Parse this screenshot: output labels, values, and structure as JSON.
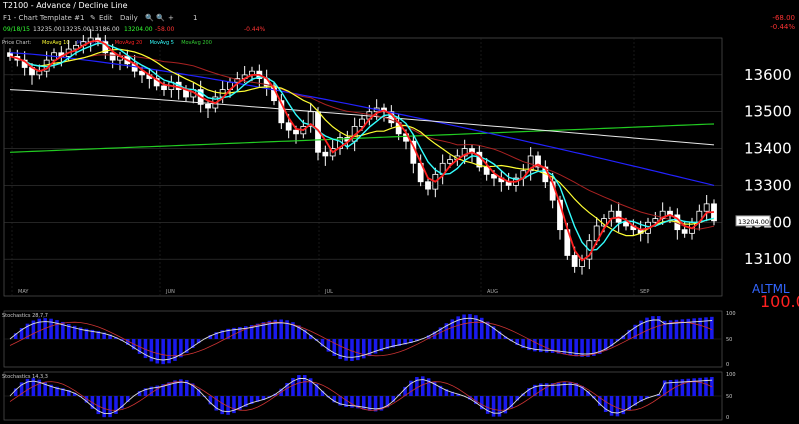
{
  "window": {
    "title": "T2100  -  Advance / Decline Line"
  },
  "toolbar": {
    "template": "F1 - Chart Template #1",
    "edit": "Edit",
    "interval": "Daily",
    "count": "1"
  },
  "quote": {
    "date": "09/18/15",
    "open": "13235.00",
    "high": "13235.00",
    "low": "13186.00",
    "close": "13204.00",
    "change": "-58.00",
    "change_pct": "-0.44%"
  },
  "top_right": {
    "change": "-68.00",
    "change_pct": "-0.44%"
  },
  "price_panel": {
    "label": "Price Chart",
    "legend": [
      {
        "text": "MovAvg 10",
        "color": "#ffff33"
      },
      {
        "text": "MovAvg 100",
        "color": "#3333ff"
      },
      {
        "text": "MovAvg 20",
        "color": "#ff2222"
      },
      {
        "text": "MovAvg 5",
        "color": "#33ffff"
      },
      {
        "text": "MovAvg 200",
        "color": "#33cc33"
      }
    ],
    "y_ticks": [
      "13600",
      "13500",
      "13400",
      "13300",
      "13200",
      "13100"
    ],
    "last_price_label": "13204.00",
    "months": [
      "MAY",
      "JUN",
      "JUL",
      "AUG",
      "SEP"
    ]
  },
  "aml": {
    "label": "ALTML",
    "value": "100.0"
  },
  "stoch_panels": [
    {
      "label": "Stochastics 28,7,7",
      "ticks": [
        "100",
        "50",
        "0"
      ]
    },
    {
      "label": "Stochastics 14,3,3",
      "ticks": [
        "100",
        "50",
        "0"
      ]
    }
  ],
  "chart_data": {
    "type": "candlestick",
    "title": "T2100 - Advance / Decline Line",
    "ylim": [
      13000,
      13700
    ],
    "closes": [
      13650,
      13640,
      13620,
      13600,
      13610,
      13640,
      13660,
      13650,
      13670,
      13680,
      13690,
      13700,
      13690,
      13660,
      13640,
      13650,
      13630,
      13610,
      13600,
      13590,
      13570,
      13560,
      13580,
      13560,
      13540,
      13560,
      13520,
      13510,
      13540,
      13560,
      13580,
      13590,
      13600,
      13610,
      13590,
      13570,
      13530,
      13470,
      13450,
      13440,
      13460,
      13500,
      13390,
      13380,
      13400,
      13430,
      13420,
      13460,
      13480,
      13500,
      13510,
      13500,
      13470,
      13440,
      13420,
      13360,
      13310,
      13290,
      13330,
      13360,
      13370,
      13380,
      13400,
      13390,
      13350,
      13330,
      13320,
      13310,
      13300,
      13320,
      13340,
      13380,
      13350,
      13310,
      13260,
      13180,
      13110,
      13080,
      13100,
      13150,
      13190,
      13210,
      13230,
      13200,
      13190,
      13180,
      13170,
      13200,
      13210,
      13230,
      13220,
      13180,
      13170,
      13200,
      13230,
      13250,
      13204
    ],
    "ma_periods": [
      5,
      10,
      20,
      100,
      200
    ]
  }
}
